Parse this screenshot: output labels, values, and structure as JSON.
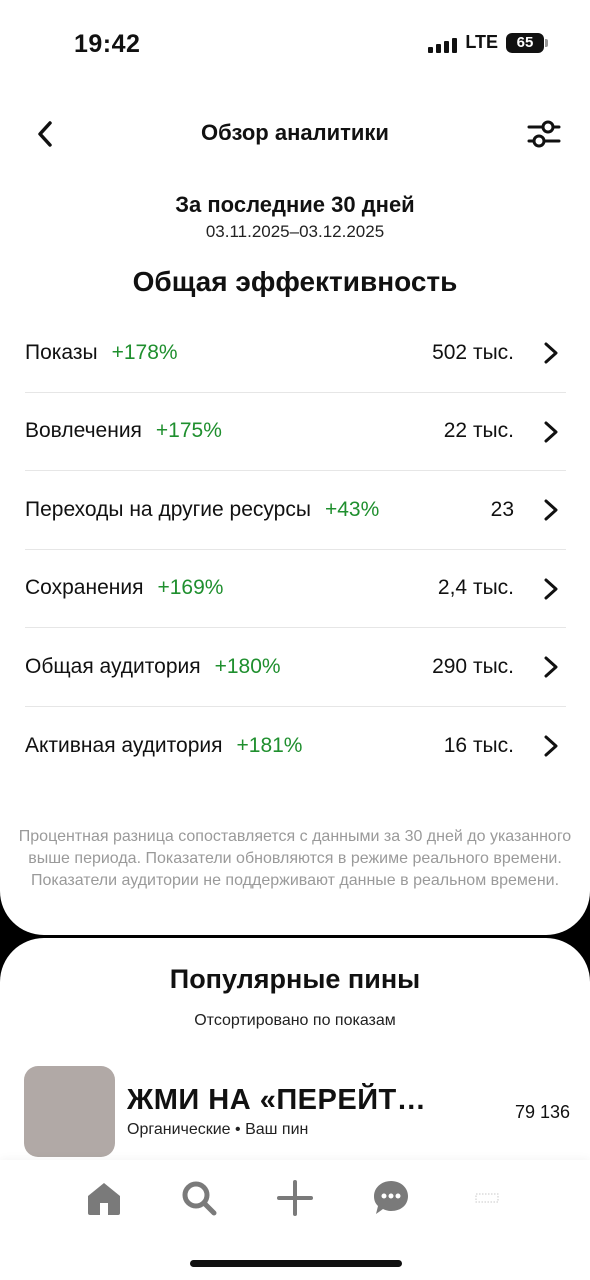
{
  "status_bar": {
    "time": "19:42",
    "network": "LTE",
    "battery": "65"
  },
  "header": {
    "title": "Обзор аналитики",
    "back_icon": "chevron-left-icon",
    "filter_icon": "sliders-icon"
  },
  "period": {
    "title": "За последние 30 дней",
    "range": "03.11.2025–03.12.2025"
  },
  "section_title": "Общая эффективность",
  "metrics": [
    {
      "label": "Показы",
      "change": "+178%",
      "value": "502 тыс."
    },
    {
      "label": "Вовлечения",
      "change": "+175%",
      "value": "22 тыс."
    },
    {
      "label": "Переходы на другие ресурсы",
      "change": "+43%",
      "value": "23"
    },
    {
      "label": "Сохранения",
      "change": "+169%",
      "value": "2,4 тыс."
    },
    {
      "label": "Общая аудитория",
      "change": "+180%",
      "value": "290 тыс."
    },
    {
      "label": "Активная аудитория",
      "change": "+181%",
      "value": "16 тыс."
    }
  ],
  "footnote": "Процентная разница сопоставляется с данными за 30 дней до указанного выше периода. Показатели обновляются в режиме реального времени. Показатели аудитории не поддерживают данные в реальном времени.",
  "popular_pins": {
    "title": "Популярные пины",
    "subtitle": "Отсортировано по показам",
    "items": [
      {
        "title": "ЖМИ НА «ПЕРЕЙТ…",
        "meta": "Органические • Ваш пин",
        "count": "79 136"
      }
    ]
  },
  "tab_bar": [
    "home-icon",
    "search-icon",
    "plus-icon",
    "chat-icon",
    "profile-icon"
  ],
  "colors": {
    "positive": "#1f8f2e",
    "muted_text": "#9a9a9a",
    "thumb": "#b1a9a6"
  }
}
